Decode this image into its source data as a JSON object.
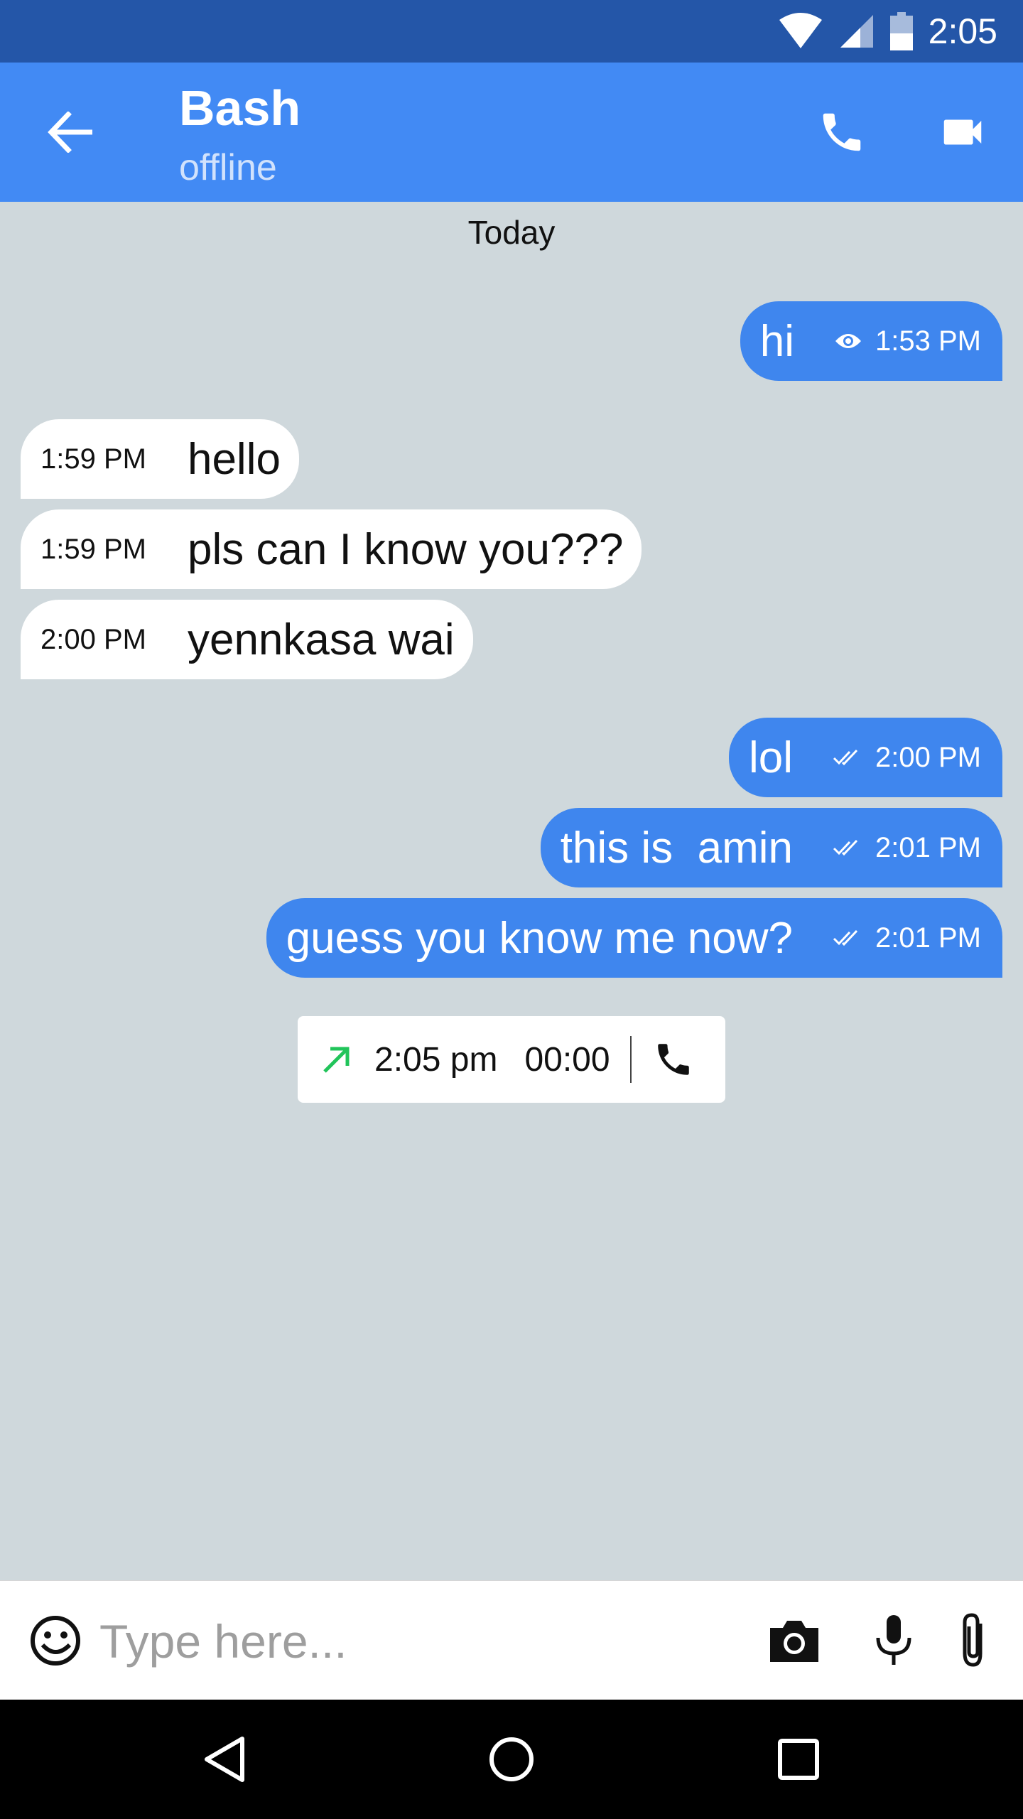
{
  "status_bar": {
    "time": "2:05"
  },
  "header": {
    "contact_name": "Bash",
    "contact_status": "offline"
  },
  "chat": {
    "date_separator": "Today",
    "messages": [
      {
        "direction": "out",
        "text": "hi",
        "time": "1:53 PM",
        "status_icon": "eye-icon"
      },
      {
        "direction": "in",
        "text": "hello",
        "time": "1:59 PM"
      },
      {
        "direction": "in",
        "text": "pls can I know you???",
        "time": "1:59 PM"
      },
      {
        "direction": "in",
        "text": "yennkasa wai",
        "time": "2:00 PM"
      },
      {
        "direction": "out",
        "text": "lol",
        "time": "2:00 PM",
        "status_icon": "double-check-icon"
      },
      {
        "direction": "out",
        "text": "this is  amin",
        "time": "2:01 PM",
        "status_icon": "double-check-icon"
      },
      {
        "direction": "out",
        "text": "guess you know me now?",
        "time": "2:01 PM",
        "status_icon": "double-check-icon"
      }
    ],
    "call_log": {
      "time": "2:05 pm",
      "duration": "00:00",
      "arrow_color": "#21c45a"
    }
  },
  "composer": {
    "placeholder": "Type here..."
  },
  "colors": {
    "status_bar": "#2456a8",
    "app_bar": "#428af4",
    "outgoing_bubble": "#3f86ee",
    "incoming_bubble": "#ffffff",
    "chat_background": "#cfd8dc"
  }
}
